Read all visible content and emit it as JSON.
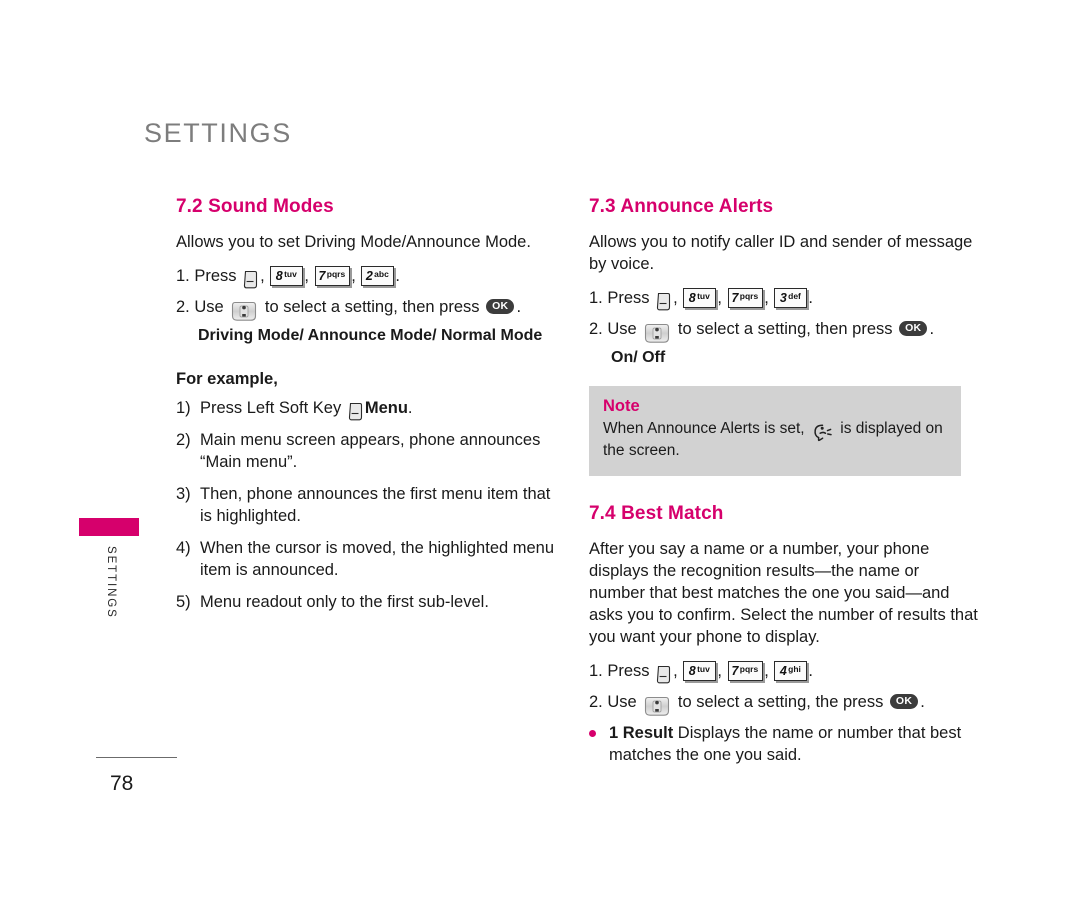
{
  "chapter": {
    "title": "SETTINGS",
    "side_label": "SETTINGS",
    "page_number": "78"
  },
  "colors": {
    "accent_magenta": "#D6006C",
    "chapter_gray": "#7D7D7D",
    "note_background": "#D2D2D2"
  },
  "left_column": {
    "section": {
      "heading": "7.2 Sound Modes",
      "intro": "Allows you to set Driving Mode/Announce Mode.",
      "step1_prefix": "1. Press",
      "step1_keys": [
        {
          "icon": "left-soft-key-icon"
        },
        {
          "digit": "8",
          "letters": "tuv"
        },
        {
          "digit": "7",
          "letters": "pqrs"
        },
        {
          "digit": "2",
          "letters": "abc"
        }
      ],
      "step1_suffix": ".",
      "step2_prefix": "2. Use",
      "step2_middle": "to select a setting, then press",
      "step2_ok": "OK",
      "step2_suffix": ".",
      "options": "Driving Mode/ Announce Mode/ Normal Mode",
      "for_example_label": "For example,",
      "example_steps": [
        {
          "marker": "1)",
          "text_before": "Press Left Soft Key",
          "icon": "left-soft-key-icon",
          "text_bold": "Menu",
          "text_after": "."
        },
        {
          "marker": "2)",
          "text": "Main menu screen appears, phone announces “Main menu”."
        },
        {
          "marker": "3)",
          "text": "Then, phone announces the first menu item that is highlighted."
        },
        {
          "marker": "4)",
          "text": "When the cursor is moved, the highlighted menu item is announced."
        },
        {
          "marker": "5)",
          "text": "Menu readout only to the first sub-level."
        }
      ]
    }
  },
  "right_column": {
    "announce_alerts": {
      "heading": "7.3 Announce Alerts",
      "intro": "Allows you to notify caller ID and sender of message by voice.",
      "step1_prefix": "1. Press",
      "step1_keys": [
        {
          "icon": "left-soft-key-icon"
        },
        {
          "digit": "8",
          "letters": "tuv"
        },
        {
          "digit": "7",
          "letters": "pqrs"
        },
        {
          "digit": "3",
          "letters": "def"
        }
      ],
      "step1_suffix": ".",
      "step2_prefix": "2. Use",
      "step2_middle": "to select a setting, then press",
      "step2_ok": "OK",
      "step2_suffix": ".",
      "options": "On/ Off"
    },
    "note": {
      "title": "Note",
      "text_before": "When Announce Alerts is set,",
      "icon": "announce-alerts-icon",
      "text_after": "is displayed on the screen."
    },
    "best_match": {
      "heading": "7.4 Best Match",
      "intro": "After you say a name or a number, your phone displays the recognition results—the name or number that best matches the one you said—and asks you to confirm. Select the number of results that you want your phone to display.",
      "step1_prefix": "1. Press",
      "step1_keys": [
        {
          "icon": "left-soft-key-icon"
        },
        {
          "digit": "8",
          "letters": "tuv"
        },
        {
          "digit": "7",
          "letters": "pqrs"
        },
        {
          "digit": "4",
          "letters": "ghi"
        }
      ],
      "step1_suffix": ".",
      "step2_prefix": "2. Use",
      "step2_middle": "to select a setting, the press",
      "step2_ok": "OK",
      "step2_suffix": ".",
      "bullets": [
        {
          "label": "1 Result",
          "text": "Displays the name or number that best matches the one you said."
        }
      ]
    }
  }
}
